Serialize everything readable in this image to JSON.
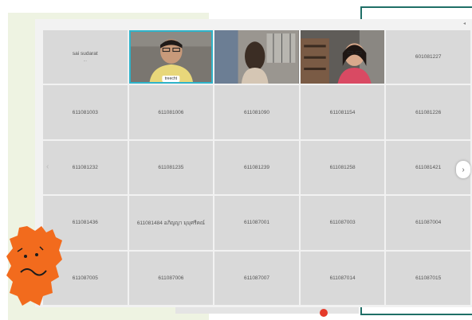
{
  "meeting": {
    "participants": [
      {
        "label": "sai sudarat",
        "sub": "...",
        "kind": "name"
      },
      {
        "label": "treecht",
        "kind": "video",
        "active": true
      },
      {
        "label": "",
        "kind": "video"
      },
      {
        "label": "",
        "kind": "video"
      },
      {
        "label": "601081227",
        "kind": "name"
      },
      {
        "label": "611081003",
        "kind": "name"
      },
      {
        "label": "611081006",
        "kind": "name"
      },
      {
        "label": "611081090",
        "kind": "name"
      },
      {
        "label": "611081154",
        "kind": "name"
      },
      {
        "label": "611081226",
        "kind": "name"
      },
      {
        "label": "611081232",
        "kind": "name"
      },
      {
        "label": "611081235",
        "kind": "name"
      },
      {
        "label": "611081239",
        "kind": "name"
      },
      {
        "label": "611081258",
        "kind": "name"
      },
      {
        "label": "611081421",
        "kind": "name"
      },
      {
        "label": "611081436",
        "kind": "name"
      },
      {
        "label": "611081484 อภิญญา มุมุศรีคณ์",
        "kind": "name"
      },
      {
        "label": "611087001",
        "kind": "name"
      },
      {
        "label": "611087003",
        "kind": "name"
      },
      {
        "label": "611087004",
        "kind": "name"
      },
      {
        "label": "611087005",
        "kind": "name"
      },
      {
        "label": "611087006",
        "kind": "name"
      },
      {
        "label": "611087007",
        "kind": "name"
      },
      {
        "label": "611087014",
        "kind": "name"
      },
      {
        "label": "611087015",
        "kind": "name"
      }
    ],
    "next_icon": "›",
    "prev_icon": "‹",
    "more_icon": "◂"
  },
  "colors": {
    "accent": "#2fb3c9",
    "frame_line": "#1f6f67",
    "tile": "#d9d9d9",
    "mascot": "#f26b1d"
  }
}
